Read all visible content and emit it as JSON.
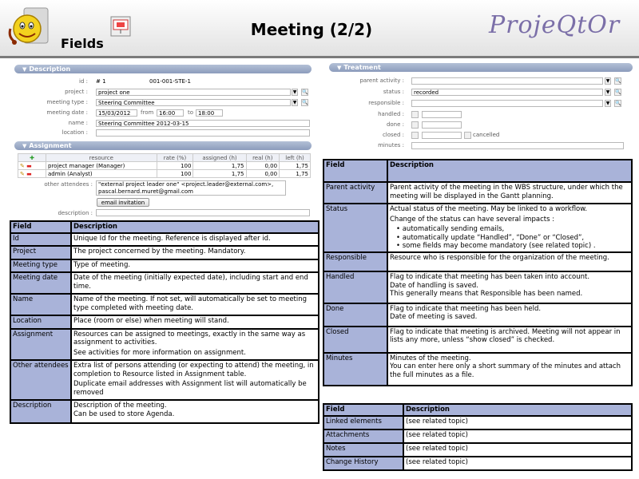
{
  "header": {
    "fields_title": "Fields",
    "slide_title": "Meeting (2/2)",
    "brand": "ProjeQtOr"
  },
  "description_panel": {
    "title": "Description",
    "id_label": "id :",
    "id_value": "# 1",
    "reference": "001-001-STE-1",
    "project_label": "project :",
    "project_value": "project one",
    "meeting_type_label": "meeting type :",
    "meeting_type_value": "Steering Committee",
    "meeting_date_label": "meeting date :",
    "meeting_date_value": "15/03/2012",
    "from_label": "from",
    "from_value": "16:00",
    "to_label": "to",
    "to_value": "18:00",
    "name_label": "name :",
    "name_value": "Steering Committee 2012-03-15",
    "location_label": "location :",
    "location_value": ""
  },
  "assignment_panel": {
    "title": "Assignment",
    "columns": [
      "resource",
      "rate (%)",
      "assigned (h)",
      "real (h)",
      "left (h)"
    ],
    "rows": [
      [
        "project manager (Manager)",
        "100",
        "1,75",
        "0,00",
        "1,75"
      ],
      [
        "admin (Analyst)",
        "100",
        "1,75",
        "0,00",
        "1,75"
      ]
    ],
    "other_attendees_label": "other attendees :",
    "other_attendees_value": "\"external project leader one\" <project.leader@external.com>, pascal.bernard.muret@gmail.com",
    "email_button": "email invitation",
    "description_label": "description :"
  },
  "treatment_panel": {
    "title": "Treatment",
    "parent_activity_label": "parent activity :",
    "status_label": "status :",
    "status_value": "recorded",
    "responsible_label": "responsible :",
    "handled_label": "handled :",
    "done_label": "done :",
    "closed_label": "closed :",
    "cancelled_label": "cancelled",
    "minutes_label": "minutes :"
  },
  "left_table": {
    "header": [
      "Field",
      "Description"
    ],
    "rows": [
      {
        "field": "Id",
        "desc": [
          "Unique Id for the meeting. Reference is displayed after id."
        ]
      },
      {
        "field": "Project",
        "desc": [
          "The project concerned by the meeting. Mandatory."
        ]
      },
      {
        "field": "Meeting type",
        "desc": [
          "Type of meeting."
        ]
      },
      {
        "field": "Meeting date",
        "desc": [
          "Date of the meeting (initially expected date), including start and end time."
        ]
      },
      {
        "field": "Name",
        "desc": [
          "Name of the meeting. If not set, will automatically be set to meeting type completed with meeting date."
        ]
      },
      {
        "field": "Location",
        "desc": [
          "Place (room or else) when meeting will stand."
        ]
      },
      {
        "field": "Assignment",
        "desc": [
          "Resources can be assigned to meetings, exactly in the same way as assignment to activities.",
          "See activities for more information on assignment."
        ]
      },
      {
        "field": "Other attendees",
        "desc": [
          "Extra list of persons attending (or expecting to attend) the meeting, in completion to Resource listed in Assignment table.",
          "Duplicate email addresses with Assignment list will automatically be removed"
        ]
      },
      {
        "field": "Description",
        "desc": [
          "Description of the meeting.",
          "Can be used to store Agenda."
        ]
      }
    ]
  },
  "right_table": {
    "header": [
      "Field",
      "Description"
    ],
    "rows": [
      {
        "field": "Parent activity",
        "desc": [
          "Parent activity of the meeting in the WBS structure, under which the meeting will be displayed in the Gantt planning."
        ]
      },
      {
        "field": "Status",
        "desc": [
          "Actual status of the meeting. May be linked to a workflow.",
          "Change of the status can have several impacts :"
        ],
        "bullets": [
          "automatically sending emails,",
          "automatically update “Handled”, “Done” or “Closed”,",
          "some fields may become mandatory (see related topic) ."
        ]
      },
      {
        "field": "Responsible",
        "desc": [
          "Resource who is responsible for the organization of the meeting."
        ]
      },
      {
        "field": "Handled",
        "desc": [
          "Flag to indicate that meeting has been taken into account.",
          "Date of handling is saved.",
          "This generally means that Responsible has been named."
        ]
      },
      {
        "field": "Done",
        "desc": [
          "Flag to indicate that meeting has been held.",
          "Date of meeting is saved."
        ]
      },
      {
        "field": "Closed",
        "desc": [
          "Flag to indicate that meeting is archived. Meeting will not appear in lists any more, unless “show closed” is checked."
        ]
      },
      {
        "field": "Minutes",
        "desc": [
          "Minutes of the meeting.",
          "You can enter here only a short summary of the minutes and attach the full minutes as a file."
        ]
      }
    ]
  },
  "bottom_table": {
    "header": [
      "Field",
      "Description"
    ],
    "rows": [
      {
        "field": "Linked elements",
        "desc": "(see related topic)"
      },
      {
        "field": "Attachments",
        "desc": "(see related topic)"
      },
      {
        "field": "Notes",
        "desc": "(see related topic)"
      },
      {
        "field": "Change History",
        "desc": "(see related topic)"
      }
    ]
  }
}
